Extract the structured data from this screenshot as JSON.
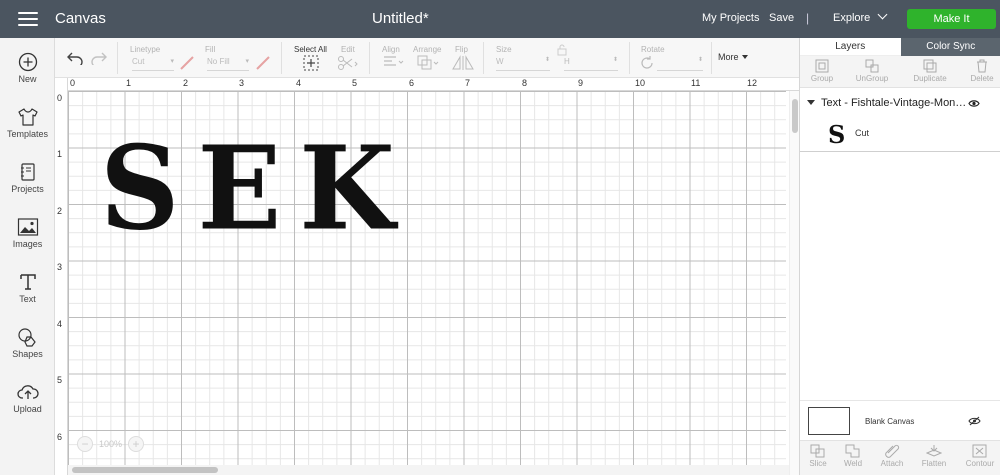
{
  "topbar": {
    "app_title": "Canvas",
    "doc_title": "Untitled*",
    "my_projects": "My Projects",
    "save": "Save",
    "separator": "|",
    "explore": "Explore",
    "make_it": "Make It",
    "make_it_color": "#2fb32c",
    "bar_color": "#4b5560"
  },
  "leftbar": {
    "items": [
      {
        "label": "New",
        "icon": "plus-circle-icon"
      },
      {
        "label": "Templates",
        "icon": "tshirt-icon"
      },
      {
        "label": "Projects",
        "icon": "notebook-icon"
      },
      {
        "label": "Images",
        "icon": "image-icon"
      },
      {
        "label": "Text",
        "icon": "text-t-icon"
      },
      {
        "label": "Shapes",
        "icon": "shapes-icon"
      },
      {
        "label": "Upload",
        "icon": "cloud-upload-icon"
      }
    ]
  },
  "toolbar": {
    "linetype_label": "Linetype",
    "linetype_value": "Cut",
    "fill_label": "Fill",
    "fill_value": "No Fill",
    "select_all_label": "Select All",
    "edit_label": "Edit",
    "align_label": "Align",
    "arrange_label": "Arrange",
    "flip_label": "Flip",
    "size_label": "Size",
    "size_w": "W",
    "size_h": "H",
    "rotate_label": "Rotate",
    "more_label": "More"
  },
  "canvas": {
    "ruler_top": [
      "0",
      "1",
      "2",
      "3",
      "4",
      "5",
      "6",
      "7",
      "8",
      "9",
      "10",
      "11",
      "12"
    ],
    "ruler_left": [
      "0",
      "1",
      "2",
      "3",
      "4",
      "5",
      "6"
    ],
    "text_content": "SEK",
    "zoom_minus": "−",
    "zoom_value": "100%",
    "zoom_plus": "+"
  },
  "rightpanel": {
    "tabs": [
      {
        "label": "Layers",
        "active": true
      },
      {
        "label": "Color Sync",
        "active": false
      }
    ],
    "layer_actions": [
      "Group",
      "UnGroup",
      "Duplicate",
      "Delete"
    ],
    "layer_name": "Text - Fishtale-Vintage-Mon…",
    "sublayer_glyph": "S",
    "sublayer_label": "Cut",
    "blank_canvas_label": "Blank Canvas",
    "bottom_actions": [
      "Slice",
      "Weld",
      "Attach",
      "Flatten",
      "Contour"
    ]
  }
}
